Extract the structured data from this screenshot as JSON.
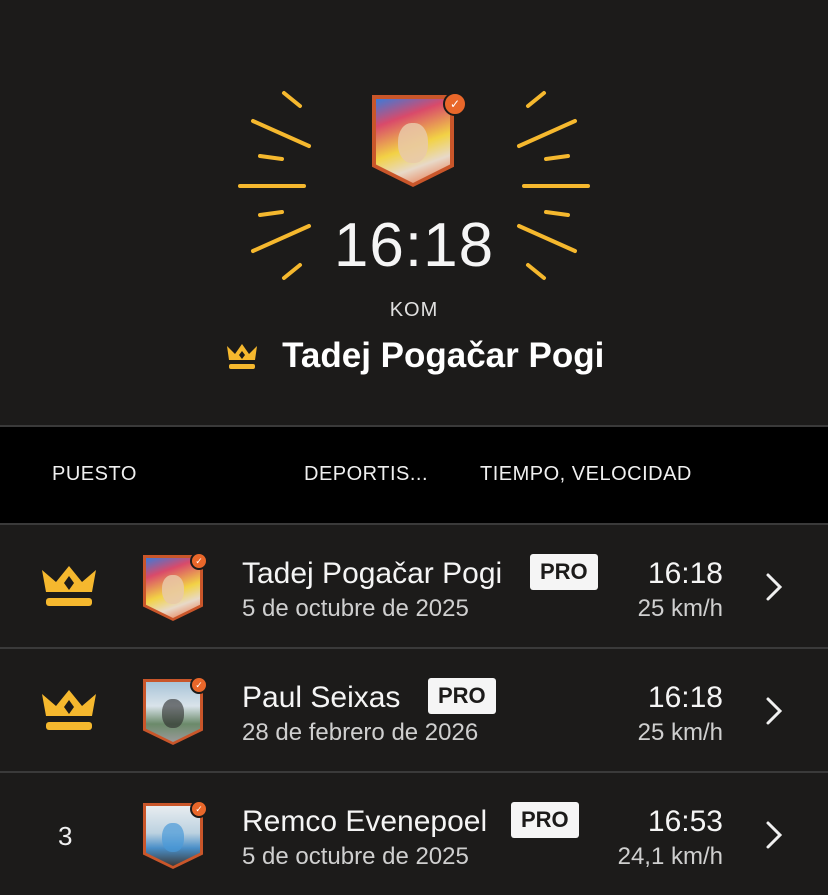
{
  "hero": {
    "time": "16:18",
    "label": "KOM",
    "name": "Tadej Pogačar Pogi"
  },
  "table": {
    "headers": {
      "rank": "PUESTO",
      "athlete": "DEPORTIS...",
      "time_speed": "TIEMPO, VELOCIDAD"
    },
    "rows": [
      {
        "rank": "",
        "rank_icon": "crown-icon",
        "name": "Tadej Pogačar Pogi",
        "badge": "PRO",
        "date": "5 de octubre de 2025",
        "time": "16:18",
        "speed": "25 km/h"
      },
      {
        "rank": "",
        "rank_icon": "crown-icon",
        "name": "Paul  Seixas",
        "badge": "PRO",
        "date": "28 de febrero de 2026",
        "time": "16:18",
        "speed": "25 km/h"
      },
      {
        "rank": "3",
        "rank_icon": "",
        "name": "Remco Evenepoel",
        "badge": "PRO",
        "date": "5 de octubre de 2025",
        "time": "16:53",
        "speed": "24,1 km/h"
      }
    ]
  },
  "colors": {
    "accent": "#f5b82e",
    "background": "#1c1b1a",
    "header_bg": "#000000",
    "badge": "#e9672a"
  }
}
